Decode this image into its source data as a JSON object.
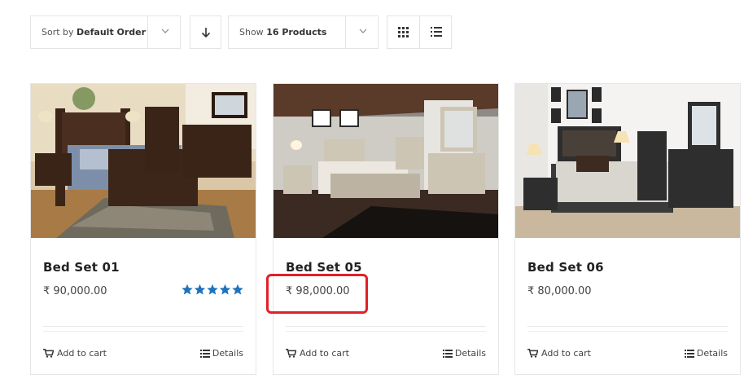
{
  "toolbar": {
    "sort": {
      "prefix": "Sort by",
      "value": "Default Order"
    },
    "show": {
      "prefix": "Show",
      "value": "16 Products"
    }
  },
  "products": [
    {
      "title": "Bed Set 01",
      "price": "₹ 90,000.00",
      "rating_stars": 5,
      "add_to_cart": "Add to cart",
      "details": "Details"
    },
    {
      "title": "Bed Set 05",
      "price": "₹ 98,000.00",
      "add_to_cart": "Add to cart",
      "details": "Details"
    },
    {
      "title": "Bed Set 06",
      "price": "₹ 80,000.00",
      "add_to_cart": "Add to cart",
      "details": "Details"
    }
  ],
  "colors": {
    "rating": "#1e73be",
    "highlight": "#e0202a"
  }
}
